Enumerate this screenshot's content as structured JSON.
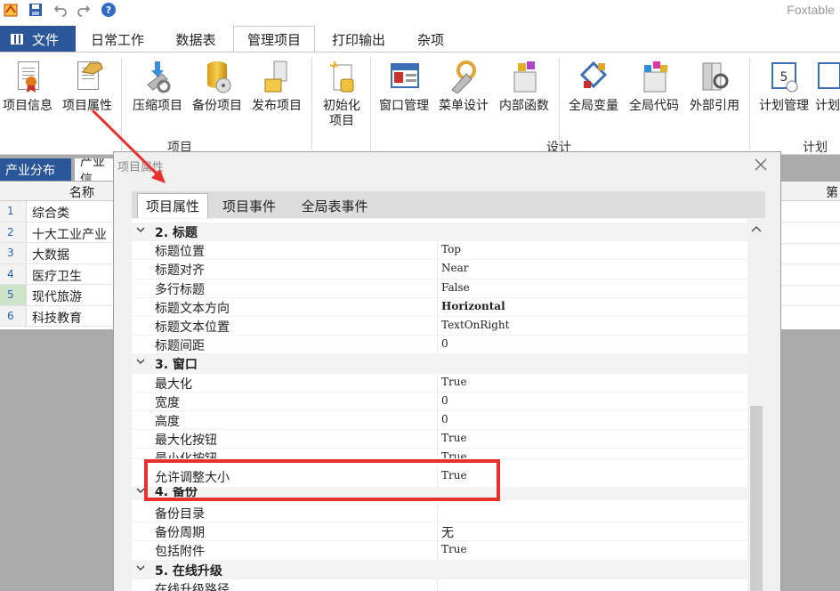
{
  "app": {
    "title": "Foxtable"
  },
  "ribbon_tabs": {
    "file": "文件",
    "daily": "日常工作",
    "tables": "数据表",
    "manage": "管理项目",
    "print": "打印输出",
    "misc": "杂项"
  },
  "ribbon": {
    "project_group": {
      "label": "项目",
      "buttons": {
        "info": "项目信息",
        "props": "项目属性",
        "compress": "压缩项目",
        "backup": "备份项目",
        "publish": "发布项目",
        "init_line1": "初始化",
        "init_line2": "项目"
      }
    },
    "design_group": {
      "label": "设计",
      "buttons": {
        "window": "窗口管理",
        "menu": "菜单设计",
        "func": "内部函数",
        "globals": "全局变量",
        "code": "全局代码",
        "refs": "外部引用"
      }
    },
    "plan_group": {
      "label": "计划",
      "buttons": {
        "plan": "计划管理",
        "plan2": "计划"
      }
    }
  },
  "bg_table": {
    "tabs": [
      "产业分布",
      "产业信"
    ],
    "col_header": "名称",
    "right_header": "第",
    "rows": [
      {
        "num": "1",
        "name": "综合类"
      },
      {
        "num": "2",
        "name": "十大工业产业"
      },
      {
        "num": "3",
        "name": "大数据"
      },
      {
        "num": "4",
        "name": "医疗卫生"
      },
      {
        "num": "5",
        "name": "现代旅游"
      },
      {
        "num": "6",
        "name": "科技教育"
      }
    ]
  },
  "dialog": {
    "title": "项目属性",
    "tabs": {
      "props": "项目属性",
      "events": "项目事件",
      "table_events": "全局表事件"
    },
    "sections": {
      "title": {
        "label": "2. 标题",
        "rows": [
          {
            "name": "标题位置",
            "value": "Top"
          },
          {
            "name": "标题对齐",
            "value": "Near"
          },
          {
            "name": "多行标题",
            "value": "False"
          },
          {
            "name": "标题文本方向",
            "value": "Horizontal"
          },
          {
            "name": "标题文本位置",
            "value": "TextOnRight"
          },
          {
            "name": "标题间距",
            "value": "0"
          }
        ]
      },
      "window": {
        "label": "3. 窗口",
        "rows": [
          {
            "name": "最大化",
            "value": "True"
          },
          {
            "name": "宽度",
            "value": "0"
          },
          {
            "name": "高度",
            "value": "0"
          },
          {
            "name": "最大化按钮",
            "value": "True"
          },
          {
            "name": "最小化按钮",
            "value": "True"
          },
          {
            "name": "允许调整大小",
            "value": "True"
          }
        ]
      },
      "backup": {
        "label": "4. 备份",
        "rows": [
          {
            "name": "备份目录",
            "value": ""
          },
          {
            "name": "备份周期",
            "value": "无"
          },
          {
            "name": "包括附件",
            "value": "True"
          }
        ]
      },
      "upgrade": {
        "label": "5. 在线升级",
        "rows": [
          {
            "name": "在线升级路径",
            "value": ""
          }
        ]
      }
    }
  },
  "colors": {
    "file_tab": "#2b579a",
    "highlight": "#e8312f",
    "link": "#2a64b4"
  }
}
